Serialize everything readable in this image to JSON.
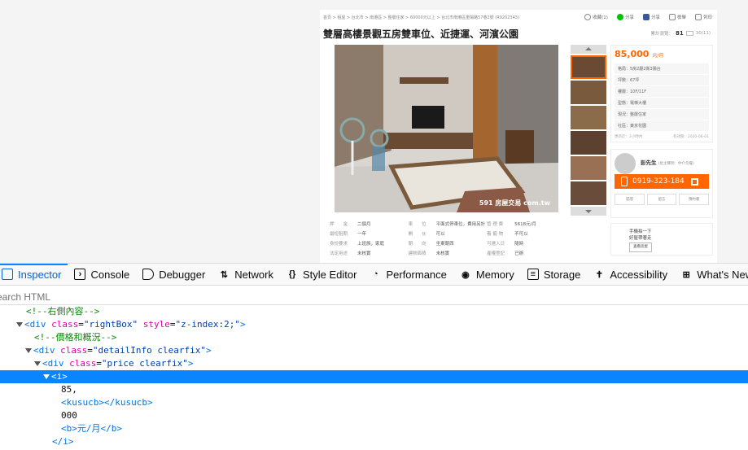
{
  "listing": {
    "breadcrumb": "首頁 > 租屋 > 台北市 > 南港區 > 整層住家 > 60000元以上 > 台北市南港區重陽路57巷2號",
    "breadcrumb_id": "(R9202343)",
    "actions": [
      "收藏(1)",
      "分享",
      "分享",
      "檢舉",
      "列印"
    ],
    "title": "雙層高樓景觀五房雙車位、近捷運、河濱公園",
    "views_label": "累計瀏覽：",
    "views_count": "81",
    "views_extra": "30(11)",
    "photo_watermark": "591 房屋交易 com.tw",
    "details": [
      [
        {
          "k": "押　　金",
          "v": "二個月"
        },
        {
          "k": "車　　位",
          "v": "平面式停車位，費用另計"
        },
        {
          "k": "管 理 費",
          "v": "5618元/月"
        }
      ],
      [
        {
          "k": "最短租期",
          "v": "一年"
        },
        {
          "k": "開　　伙",
          "v": "可以"
        },
        {
          "k": "養 寵 物",
          "v": "不可以"
        }
      ],
      [
        {
          "k": "身份要求",
          "v": "上班族，家庭"
        },
        {
          "k": "朝　　向",
          "v": "坐東朝西"
        },
        {
          "k": "可遷入日",
          "v": "隨時"
        }
      ],
      [
        {
          "k": "法定用途",
          "v": "未核實"
        },
        {
          "k": "建物面積",
          "v": "未核實"
        },
        {
          "k": "產權登記",
          "v": "已辦"
        }
      ]
    ]
  },
  "rightbox": {
    "price": "85,000",
    "price_unit": "元/月",
    "specs": [
      "格局：5房2廳2衛3陽台",
      "坪數：67坪",
      "樓層：10F/11F",
      "型態：電梯大樓",
      "現況：整層住家",
      "社區：東京花園"
    ],
    "update_time": "更新於：2小時內",
    "valid_until": "有效期：2020-06-01",
    "agent_name": "彭先生",
    "agent_role": "(屋主聲明：仲介勿擾)",
    "phone": "0919-323-184",
    "agent_actions": [
      "認證",
      "留言",
      "預約看"
    ],
    "qr_line1": "手機拍一下",
    "qr_line2": "好屋帶著走",
    "qr_button": "查看房屋"
  },
  "devtools": {
    "tabs": [
      "Inspector",
      "Console",
      "Debugger",
      "Network",
      "Style Editor",
      "Performance",
      "Memory",
      "Storage",
      "Accessibility",
      "What's New"
    ],
    "search_placeholder": "Search HTML",
    "tree": {
      "l1_comment": "<!--右側內容-->",
      "l2_tag": "div",
      "l2_attr1": "class",
      "l2_val1": "\"rightBox\"",
      "l2_attr2": "style",
      "l2_val2": "\"z-index:2;\"",
      "l3_comment": "<!--價格和概況-->",
      "l4_tag": "div",
      "l4_attr": "class",
      "l4_val": "\"detailInfo clearfix\"",
      "l5_tag": "div",
      "l5_attr": "class",
      "l5_val": "\"price clearfix\"",
      "l6_tag": "<i>",
      "l7_text": "85,",
      "l8_tag": "<kusucb></kusucb>",
      "l9_text": "000",
      "l10_text": "<b>元/月</b>",
      "l11_text": "</i>"
    }
  }
}
